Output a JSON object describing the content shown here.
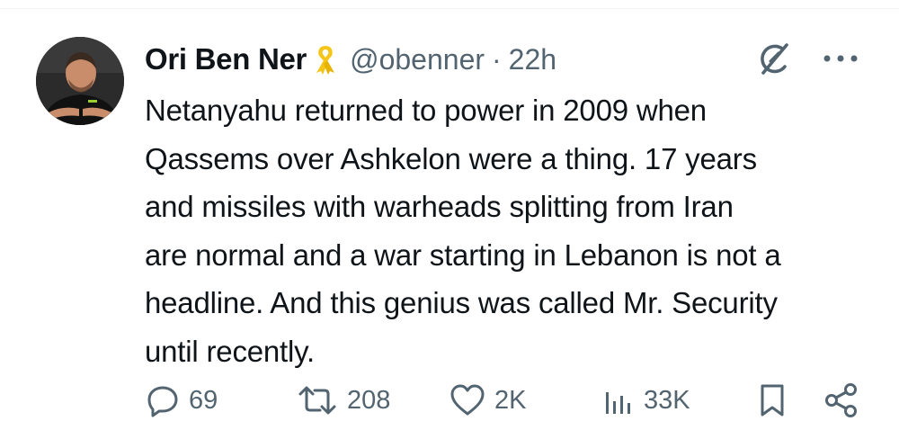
{
  "tweet": {
    "author": {
      "display_name": "Ori Ben Ner",
      "handle": "@obenner",
      "badge_icon": "yellow-ribbon-icon"
    },
    "separator": "·",
    "timestamp": "22h",
    "text_lines": [
      "Netanyahu returned to power in 2009 when",
      "Qassems over Ashkelon were a thing. 17 years",
      "and missiles with warheads splitting from Iran",
      "are normal and a war starting in Lebanon is not a",
      "headline. And this genius was called Mr. Security",
      "until recently."
    ],
    "actions": {
      "replies": "69",
      "reposts": "208",
      "likes": "2K",
      "views": "33K"
    }
  },
  "colors": {
    "text_primary": "#0f1419",
    "text_secondary": "#536471",
    "ribbon": "#f5c518",
    "divider": "#eff3f4"
  }
}
